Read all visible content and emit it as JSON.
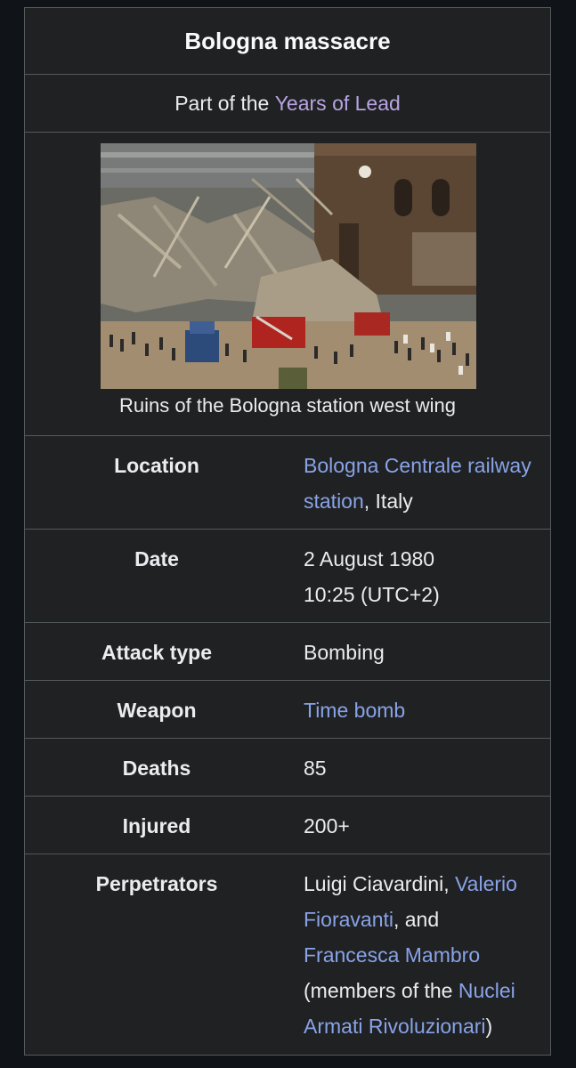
{
  "infobox": {
    "title": "Bologna massacre",
    "part_prefix": "Part of the ",
    "part_link": "Years of Lead",
    "image_caption": "Ruins of the Bologna station west wing",
    "location": {
      "label": "Location",
      "link": "Bologna Centrale railway station",
      "suffix": ", Italy"
    },
    "date": {
      "label": "Date",
      "line1": "2 August 1980",
      "line2": "10:25 (UTC+2)"
    },
    "attack_type": {
      "label": "Attack type",
      "value": "Bombing"
    },
    "weapon": {
      "label": "Weapon",
      "link": "Time bomb"
    },
    "deaths": {
      "label": "Deaths",
      "value": "85"
    },
    "injured": {
      "label": "Injured",
      "value": "200+"
    },
    "perpetrators": {
      "label": "Perpetrators",
      "text1": "Luigi Ciavardini, ",
      "link1": "Valerio Fioravanti",
      "text2": ", and ",
      "link2": "Francesca Mambro",
      "text3": " (members of the ",
      "link3": "Nuclei Armati Rivoluzionari",
      "text4": ")"
    }
  }
}
